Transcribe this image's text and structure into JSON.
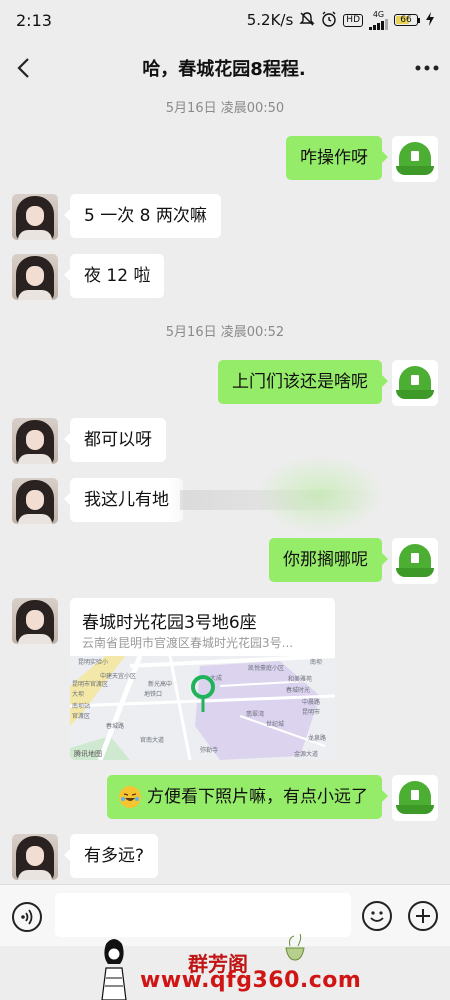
{
  "status_bar": {
    "time": "2:13",
    "network_speed": "5.2K/s",
    "network_type": "4G",
    "hd_badge": "HD",
    "battery": "66",
    "icons": [
      "mute-icon",
      "alarm-icon",
      "hd-icon",
      "signal-icon",
      "battery-icon",
      "charging-icon"
    ]
  },
  "header": {
    "title": "哈，春城花园8程程.",
    "back_icon": "chevron-left-icon",
    "more_icon": "more-dots-icon"
  },
  "timestamps": [
    "5月16日 凌晨00:50",
    "5月16日 凌晨00:52"
  ],
  "messages": [
    {
      "side": "right",
      "text": "咋操作呀"
    },
    {
      "side": "left",
      "text": "5 一次 8 两次嘛"
    },
    {
      "side": "left",
      "text": "夜 12 啦"
    },
    {
      "side": "right",
      "text": "上门们该还是啥呢"
    },
    {
      "side": "left",
      "text": "都可以呀"
    },
    {
      "side": "left",
      "text": "我这儿有地"
    },
    {
      "side": "right",
      "text": "你那搁哪呢"
    },
    {
      "side": "right",
      "text": "方便看下照片嘛，有点小远了",
      "emoji": "laughing-crying-emoji"
    },
    {
      "side": "left",
      "text": "有多远?"
    }
  ],
  "location_card": {
    "title": "春城时光花园3号地6座",
    "address": "云南省昆明市官渡区春城时光花园3号...",
    "map_labels": [
      "昆明实验小",
      "南坝",
      "凯悦豪庭小区",
      "和美雅苑",
      "中建天宜小区",
      "昆明市官渡区",
      "春城时光",
      "中晨路",
      "大坝",
      "新光高中",
      "地铁口",
      "南坝站",
      "昆明市",
      "世纪城",
      "官渡区",
      "翡翠湾",
      "弥勒寺",
      "龙泉路",
      "金源大道",
      "大成",
      "春城路",
      "官南大道"
    ],
    "map_brand": "腾讯地图",
    "pin_icon": "location-pin-icon"
  },
  "input_bar": {
    "placeholder": "",
    "voice_icon": "voice-icon",
    "emoji_icon": "emoji-icon",
    "plus_icon": "plus-icon"
  },
  "watermark": {
    "text": "群芳阁",
    "url": "www.qfg360.com"
  },
  "colors": {
    "background": "#ededed",
    "bubble_self": "#95ec69",
    "bubble_other": "#ffffff",
    "pin": "#1fb35a",
    "watermark": "#d01515"
  }
}
